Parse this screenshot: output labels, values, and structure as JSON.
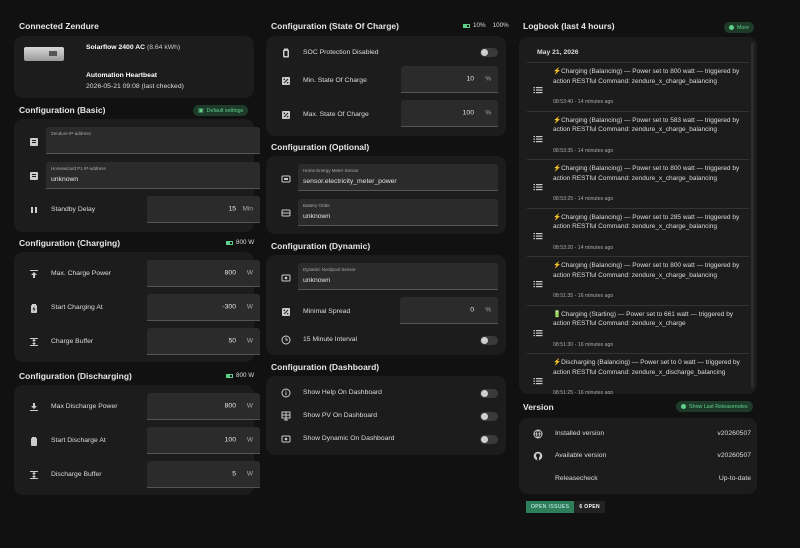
{
  "connected": {
    "title": "Connected Zendure",
    "device_name": "Solarflow 2400 AC",
    "device_capacity": "(8.64 kWh)",
    "heartbeat_label": "Automation Heartbeat",
    "heartbeat_value": "2026-05-21 09:08 (last checked)"
  },
  "basic": {
    "title": "Configuration (Basic)",
    "badge": "Default settings",
    "zendure_ip_label": "Zendure IP-address",
    "zendure_ip_value": "",
    "p1_label": "Homewizard P1 IP-address",
    "p1_value": "unknown",
    "standby_label": "Standby Delay",
    "standby_value": "15",
    "standby_unit": "Min"
  },
  "charging": {
    "title": "Configuration (Charging)",
    "stat": "800 W",
    "max_label": "Max. Charge Power",
    "max_value": "800",
    "max_unit": "W",
    "start_label": "Start Charging At",
    "start_value": "-300",
    "start_unit": "W",
    "buffer_label": "Charge Buffer",
    "buffer_value": "50",
    "buffer_unit": "W"
  },
  "discharging": {
    "title": "Configuration (Discharging)",
    "stat": "800 W",
    "max_label": "Max Discharge Power",
    "max_value": "800",
    "max_unit": "W",
    "start_label": "Start Discharge At",
    "start_value": "100",
    "start_unit": "W",
    "buffer_label": "Discharge Buffer",
    "buffer_value": "5",
    "buffer_unit": "W"
  },
  "soc": {
    "title": "Configuration (State Of Charge)",
    "stat_min": "10%",
    "stat_max": "100%",
    "protection_label": "SOC Protection Disabled",
    "min_label": "Min. State Of Charge",
    "min_value": "10",
    "min_unit": "%",
    "max_label": "Max. State Of Charge",
    "max_value": "100",
    "max_unit": "%"
  },
  "optional": {
    "title": "Configuration (Optional)",
    "energy_label": "Home Energy Meter Sensor",
    "energy_value": "sensor.electricity_meter_power",
    "order_label": "Battery Order",
    "order_value": "unknown"
  },
  "dynamic": {
    "title": "Configuration (Dynamic)",
    "nordpool_label": "Dynamic Nordpool Sensor",
    "nordpool_value": "unknown",
    "spread_label": "Minimal Spread",
    "spread_value": "0",
    "spread_unit": "%",
    "interval_label": "15 Minute Interval"
  },
  "dashboard": {
    "title": "Configuration (Dashboard)",
    "help_label": "Show Help On Dashboard",
    "pv_label": "Show PV On Dashboard",
    "dynamic_label": "Show Dynamic On Dashboard"
  },
  "logbook": {
    "title": "Logbook (last 4 hours)",
    "more": "More",
    "date": "May 21, 2026",
    "entries": [
      {
        "text": "⚡Charging (Balancing) — Power set to 800 watt — triggered by action RESTful Command: zendure_x_charge_balancing",
        "time": "08:53:40 - 14 minutes ago"
      },
      {
        "text": "⚡Charging (Balancing) — Power set to 583 watt — triggered by action RESTful Command: zendure_x_charge_balancing",
        "time": "08:53:35 - 14 minutes ago"
      },
      {
        "text": "⚡Charging (Balancing) — Power set to 800 watt — triggered by action RESTful Command: zendure_x_charge_balancing",
        "time": "08:53:25 - 14 minutes ago"
      },
      {
        "text": "⚡Charging (Balancing) — Power set to 285 watt — triggered by action RESTful Command: zendure_x_charge_balancing",
        "time": "08:53:20 - 14 minutes ago"
      },
      {
        "text": "⚡Charging (Balancing) — Power set to 800 watt — triggered by action RESTful Command: zendure_x_charge_balancing",
        "time": "08:51:35 - 16 minutes ago"
      },
      {
        "text": "🔋Charging (Starting) — Power set to 661 watt — triggered by action RESTful Command: zendure_x_charge",
        "time": "08:51:30 - 16 minutes ago"
      },
      {
        "text": "⚡Discharging (Balancing) — Power set to 0 watt — triggered by action RESTful Command: zendure_x_discharge_balancing",
        "time": "08:51:25 - 16 minutes ago"
      }
    ]
  },
  "version": {
    "title": "Version",
    "badge": "Show Last Releasenotes",
    "installed_label": "Installed version",
    "installed_value": "v20260507",
    "available_label": "Available version",
    "available_value": "v20260507",
    "check_label": "Releasecheck",
    "check_value": "Up-to-date",
    "issues_label": "OPEN ISSUES",
    "issues_value": "6 OPEN"
  },
  "colors": {
    "accent": "#5fd08a",
    "card": "#1c1c1c",
    "bg": "#111111",
    "issues_bg": "#2e7d5b"
  }
}
